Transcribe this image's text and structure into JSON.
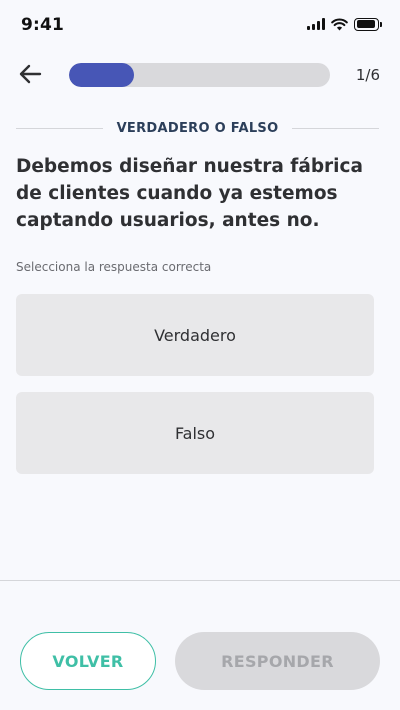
{
  "status_bar": {
    "time": "9:41",
    "icons": [
      "signal-icon",
      "wifi-icon",
      "battery-icon"
    ]
  },
  "header": {
    "back_icon": "arrow-left-icon",
    "progress_fraction": 0.25,
    "counter": "1/6"
  },
  "quiz": {
    "section_label": "VERDADERO O FALSO",
    "question": "Debemos diseñar nuestra fábrica de clientes cuando ya estemos captando usuarios, antes no.",
    "instruction": "Selecciona la respuesta correcta",
    "options": [
      {
        "label": "Verdadero"
      },
      {
        "label": "Falso"
      }
    ]
  },
  "footer": {
    "back_label": "VOLVER",
    "submit_label": "RESPONDER"
  },
  "colors": {
    "accent_blue": "#4756b6",
    "accent_teal": "#3fbfa6",
    "option_bg": "#e8e8ea",
    "disabled_bg": "#d9d9dc"
  }
}
